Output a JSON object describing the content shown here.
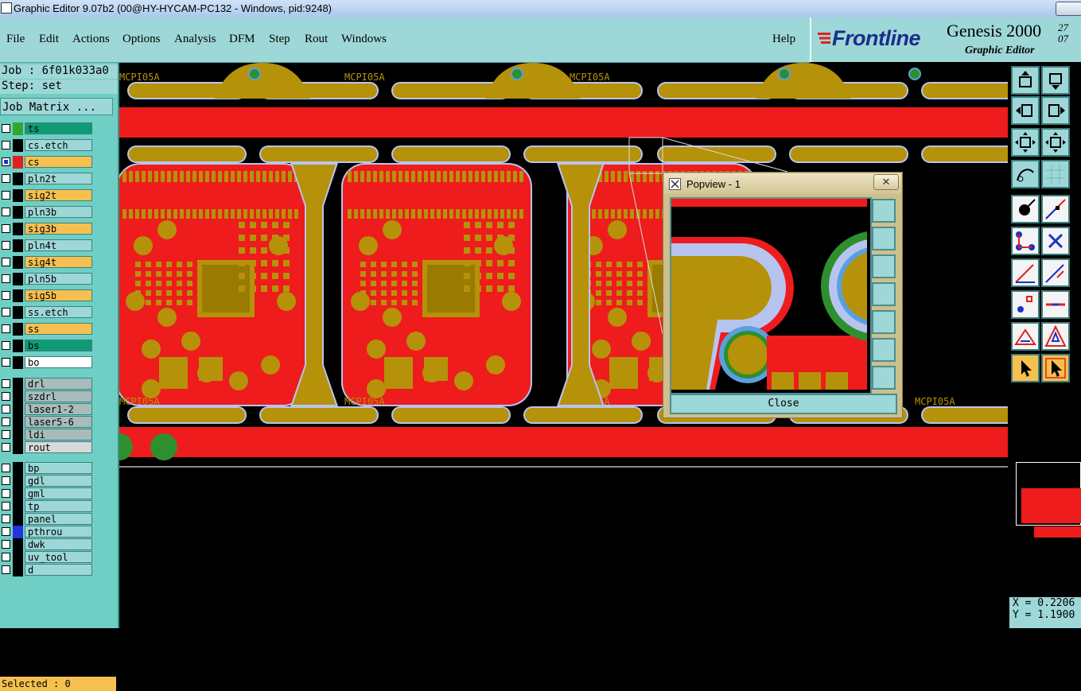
{
  "window": {
    "title": "Graphic Editor 9.07b2 (00@HY-HYCAM-PC132 - Windows, pid:9248)"
  },
  "menu": {
    "items": [
      "File",
      "Edit",
      "Actions",
      "Options",
      "Analysis",
      "DFM",
      "Step",
      "Rout",
      "Windows"
    ],
    "help": "Help"
  },
  "brand": {
    "company": "Frontline",
    "product": "Genesis 2000",
    "subtitle": "Graphic Editor",
    "date_line1": "27",
    "date_line2": "07"
  },
  "job": {
    "job_line": "Job : 6f01k033a0",
    "step_line": "Step: set",
    "matrix_button": "Job Matrix ..."
  },
  "layers": [
    {
      "name": "ts",
      "label_color": "#0f9a76",
      "swatch": "#36a432",
      "group": "board"
    },
    {
      "name": "cs.etch",
      "label_color": "#9ed7d7",
      "swatch": "#000000",
      "group": "board"
    },
    {
      "name": "cs",
      "label_color": "#f6c04f",
      "swatch": "#e02020",
      "group": "board",
      "active": true
    },
    {
      "name": "pln2t",
      "label_color": "#9ed7d7",
      "swatch": "#000000",
      "group": "board"
    },
    {
      "name": "sig2t",
      "label_color": "#f6c04f",
      "swatch": "#000000",
      "group": "board"
    },
    {
      "name": "pln3b",
      "label_color": "#9ed7d7",
      "swatch": "#000000",
      "group": "board"
    },
    {
      "name": "sig3b",
      "label_color": "#f6c04f",
      "swatch": "#000000",
      "group": "board"
    },
    {
      "name": "pln4t",
      "label_color": "#9ed7d7",
      "swatch": "#000000",
      "group": "board"
    },
    {
      "name": "sig4t",
      "label_color": "#f6c04f",
      "swatch": "#000000",
      "group": "board"
    },
    {
      "name": "pln5b",
      "label_color": "#9ed7d7",
      "swatch": "#000000",
      "group": "board"
    },
    {
      "name": "sig5b",
      "label_color": "#f6c04f",
      "swatch": "#000000",
      "group": "board"
    },
    {
      "name": "ss.etch",
      "label_color": "#9ed7d7",
      "swatch": "#000000",
      "group": "board"
    },
    {
      "name": "ss",
      "label_color": "#f6c04f",
      "swatch": "#000000",
      "group": "board"
    },
    {
      "name": "bs",
      "label_color": "#0f9a76",
      "swatch": "#000000",
      "group": "board"
    },
    {
      "name": "bo",
      "label_color": "#ffffff",
      "swatch": "#000000",
      "group": "board"
    },
    {
      "name": "drl",
      "label_color": "#a9bcbc",
      "swatch": "#000000",
      "group": "drill"
    },
    {
      "name": "szdrl",
      "label_color": "#a9bcbc",
      "swatch": "#000000",
      "group": "drill"
    },
    {
      "name": "laser1-2",
      "label_color": "#a9bcbc",
      "swatch": "#000000",
      "group": "drill"
    },
    {
      "name": "laser5-6",
      "label_color": "#a9bcbc",
      "swatch": "#000000",
      "group": "drill"
    },
    {
      "name": "ldi",
      "label_color": "#a9bcbc",
      "swatch": "#000000",
      "group": "drill"
    },
    {
      "name": "rout",
      "label_color": "#d9d9d9",
      "swatch": "#000000",
      "group": "drill"
    },
    {
      "name": "bp",
      "label_color": "#9ed7d7",
      "swatch": "#000000",
      "group": "misc"
    },
    {
      "name": "gdl",
      "label_color": "#9ed7d7",
      "swatch": "#000000",
      "group": "misc"
    },
    {
      "name": "gml",
      "label_color": "#9ed7d7",
      "swatch": "#000000",
      "group": "misc"
    },
    {
      "name": "tp",
      "label_color": "#9ed7d7",
      "swatch": "#000000",
      "group": "misc"
    },
    {
      "name": "panel",
      "label_color": "#9ed7d7",
      "swatch": "#000000",
      "group": "misc"
    },
    {
      "name": "pthrou",
      "label_color": "#9ed7d7",
      "swatch": "#2432e0",
      "group": "misc"
    },
    {
      "name": "dwk",
      "label_color": "#9ed7d7",
      "swatch": "#000000",
      "group": "misc"
    },
    {
      "name": "uv_tool",
      "label_color": "#9ed7d7",
      "swatch": "#000000",
      "group": "misc"
    },
    {
      "name": "d",
      "label_color": "#9ed7d7",
      "swatch": "#000000",
      "group": "misc"
    }
  ],
  "status": {
    "selected": "Selected : 0",
    "x": "X = 0.2206",
    "y": "Y = 1.1900"
  },
  "canvas": {
    "board_label": "MCPI05A",
    "colors": {
      "copper": "#b5920a",
      "mask": "#ee1c1c",
      "outline": "#b8c4f0",
      "pad_ring": "#2e8f2e",
      "background": "#000000"
    }
  },
  "popview": {
    "title": "Popview - 1",
    "close_x": "✕",
    "close_label": "Close"
  },
  "icons": {
    "tools": [
      "move-up-icon",
      "move-down-icon",
      "move-left-icon",
      "move-right-icon",
      "fit-icon",
      "zoom-icon",
      "snap-icon",
      "grid-icon",
      "pad-icon",
      "line-icon",
      "net-icon",
      "cross-icon",
      "draw-line-icon",
      "draw-arc-icon",
      "measure-icon",
      "edge-icon",
      "polygon-icon",
      "triangle-icon",
      "select-arrow-icon",
      "select-box-icon"
    ]
  }
}
